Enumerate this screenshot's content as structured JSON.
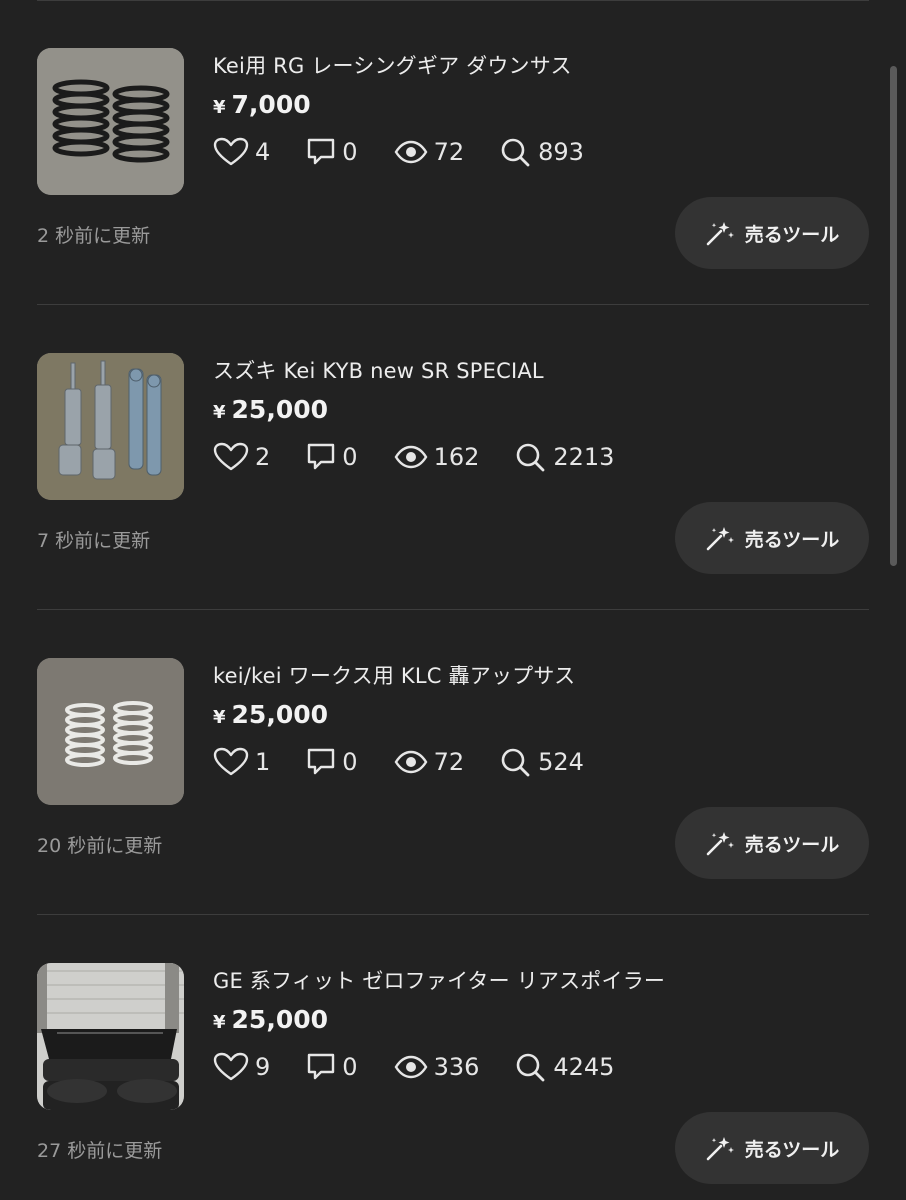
{
  "listings": [
    {
      "title": "Kei用 RG レーシングギア ダウンサス",
      "currency": "¥",
      "price": "7,000",
      "likes": "4",
      "comments": "0",
      "views": "72",
      "searches": "893",
      "updated": "2 秒前に更新",
      "sell_tool_label": "売るツール",
      "image": "black-coil-springs"
    },
    {
      "title": "スズキ Kei KYB new SR SPECIAL",
      "currency": "¥",
      "price": "25,000",
      "likes": "2",
      "comments": "0",
      "views": "162",
      "searches": "2213",
      "updated": "7 秒前に更新",
      "sell_tool_label": "売るツール",
      "image": "shock-absorbers"
    },
    {
      "title": "kei/kei ワークス用 KLC 轟アップサス",
      "currency": "¥",
      "price": "25,000",
      "likes": "1",
      "comments": "0",
      "views": "72",
      "searches": "524",
      "updated": "20 秒前に更新",
      "sell_tool_label": "売るツール",
      "image": "silver-coil-springs"
    },
    {
      "title": "GE 系フィット ゼロファイター リアスポイラー",
      "currency": "¥",
      "price": "25,000",
      "likes": "9",
      "comments": "0",
      "views": "336",
      "searches": "4245",
      "updated": "27 秒前に更新",
      "sell_tool_label": "売るツール",
      "image": "rear-spoiler-on-tires"
    }
  ],
  "icons": {
    "like": "heart-icon",
    "comment": "comment-icon",
    "view": "eye-icon",
    "search": "search-icon",
    "sell_tool": "sparkle-wand-icon"
  },
  "colors": {
    "background": "#222222",
    "button": "#333333",
    "divider": "#3d3d3d",
    "muted_text": "#9a9a9a"
  }
}
